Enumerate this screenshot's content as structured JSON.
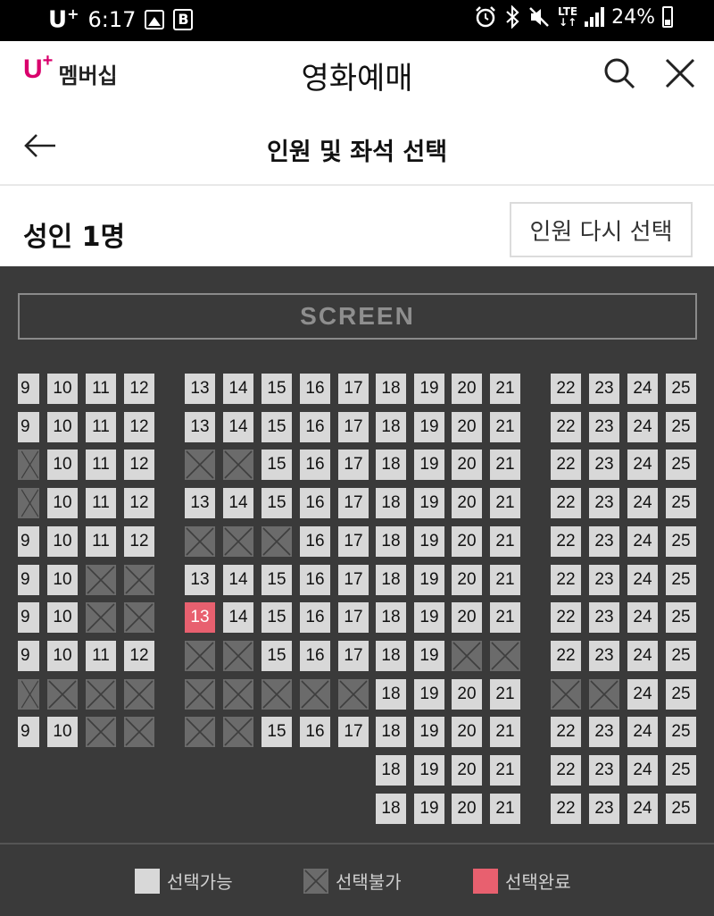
{
  "status_bar": {
    "carrier": "U",
    "carrier_sup": "+",
    "time": "6:17",
    "b_badge": "B",
    "network": "LTE",
    "battery": "24%"
  },
  "header": {
    "logo_u": "U",
    "logo_plus": "+",
    "logo_text": "멤버십",
    "title": "영화예매"
  },
  "sub_header": {
    "title": "인원 및 좌석 선택"
  },
  "person": {
    "label": "성인 1명",
    "reselect_label": "인원 다시 선택"
  },
  "seatmap": {
    "screen_label": "SCREEN",
    "rows": [
      {
        "left": [
          "9",
          "10",
          "11",
          "12"
        ],
        "mid": [
          "13",
          "14",
          "15",
          "16",
          "17",
          "18",
          "19",
          "20",
          "21"
        ],
        "right": [
          "22",
          "23",
          "24",
          "25"
        ]
      },
      {
        "left": [
          "9",
          "10",
          "11",
          "12"
        ],
        "mid": [
          "13",
          "14",
          "15",
          "16",
          "17",
          "18",
          "19",
          "20",
          "21"
        ],
        "right": [
          "22",
          "23",
          "24",
          "25"
        ]
      },
      {
        "left": [
          "X",
          "10",
          "11",
          "12"
        ],
        "mid": [
          "X",
          "X",
          "15",
          "16",
          "17",
          "18",
          "19",
          "20",
          "21"
        ],
        "right": [
          "22",
          "23",
          "24",
          "25"
        ]
      },
      {
        "left": [
          "X",
          "10",
          "11",
          "12"
        ],
        "mid": [
          "13",
          "14",
          "15",
          "16",
          "17",
          "18",
          "19",
          "20",
          "21"
        ],
        "right": [
          "22",
          "23",
          "24",
          "25"
        ]
      },
      {
        "left": [
          "9",
          "10",
          "11",
          "12"
        ],
        "mid": [
          "X",
          "X",
          "X",
          "16",
          "17",
          "18",
          "19",
          "20",
          "21"
        ],
        "right": [
          "22",
          "23",
          "24",
          "25"
        ]
      },
      {
        "left": [
          "9",
          "10",
          "X",
          "X"
        ],
        "mid": [
          "13",
          "14",
          "15",
          "16",
          "17",
          "18",
          "19",
          "20",
          "21"
        ],
        "right": [
          "22",
          "23",
          "24",
          "25"
        ]
      },
      {
        "left": [
          "9",
          "10",
          "X",
          "X"
        ],
        "mid": [
          "13*",
          "14",
          "15",
          "16",
          "17",
          "18",
          "19",
          "20",
          "21"
        ],
        "right": [
          "22",
          "23",
          "24",
          "25"
        ]
      },
      {
        "left": [
          "9",
          "10",
          "11",
          "12"
        ],
        "mid": [
          "X",
          "X",
          "15",
          "16",
          "17",
          "18",
          "19",
          "X",
          "X"
        ],
        "right": [
          "22",
          "23",
          "24",
          "25"
        ]
      },
      {
        "left": [
          "X",
          "X",
          "X",
          "X"
        ],
        "mid": [
          "X",
          "X",
          "X",
          "X",
          "X",
          "18",
          "19",
          "20",
          "21"
        ],
        "right": [
          "X",
          "X",
          "24",
          "25"
        ]
      },
      {
        "left": [
          "9",
          "10",
          "X",
          "X"
        ],
        "mid": [
          "X",
          "X",
          "15",
          "16",
          "17",
          "18",
          "19",
          "20",
          "21"
        ],
        "right": [
          "22",
          "23",
          "24",
          "25"
        ]
      },
      {
        "left": [],
        "mid": [
          "",
          "",
          "",
          "",
          "",
          "18",
          "19",
          "20",
          "21"
        ],
        "right": [
          "22",
          "23",
          "24",
          "25"
        ]
      },
      {
        "left": [],
        "mid": [
          "",
          "",
          "",
          "",
          "",
          "18",
          "19",
          "20",
          "21"
        ],
        "right": [
          "22",
          "23",
          "24",
          "25"
        ]
      }
    ]
  },
  "legend": {
    "available": "선택가능",
    "unavailable": "선택불가",
    "selected": "선택완료"
  },
  "colors": {
    "brand": "#d9006c",
    "seat_available": "#d8d8d8",
    "seat_unavailable": "#6b6b6b",
    "seat_selected": "#e8606f",
    "map_bg": "#3a3a3a"
  }
}
